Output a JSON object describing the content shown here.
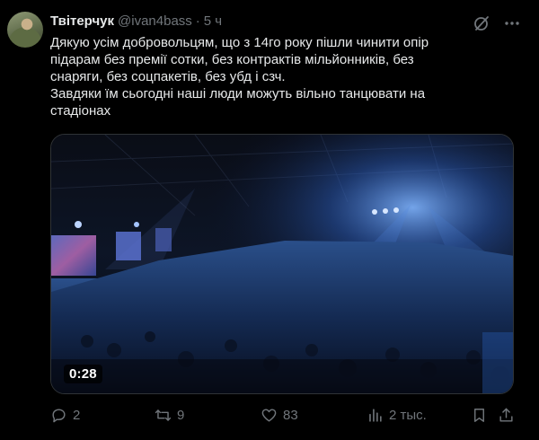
{
  "tweet": {
    "author_name": "Твітерчук",
    "handle": "@ivan4bass",
    "separator": "·",
    "time": "5 ч",
    "text": "Дякую усім добровольцям, що з 14го року пішли чинити опір\nпідарам без премії сотки, без контрактів мільйонників, без\nснаряги, без соцпакетів, без убд і сзч.\nЗавдяки їм сьогодні наші люди можуть вільно танцювати на\nстадіонах",
    "video_duration": "0:28"
  },
  "actions": {
    "replies": "2",
    "reposts": "9",
    "likes": "83",
    "views": "2 тыс."
  },
  "icons": {
    "grok": "grok-slash-icon",
    "more": "more-dots-icon",
    "reply": "reply-bubble-icon",
    "repost": "repost-icon",
    "like": "heart-icon",
    "views": "views-bars-icon",
    "bookmark": "bookmark-icon",
    "share": "share-icon"
  },
  "colors": {
    "background": "#000000",
    "text": "#e7e9ea",
    "secondary": "#71767b",
    "border": "#2f3336"
  }
}
